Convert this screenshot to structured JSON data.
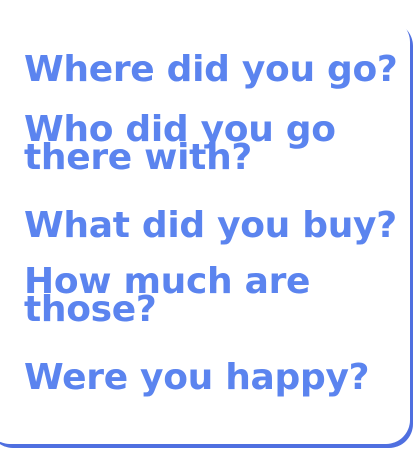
{
  "questions": [
    "Where did you go?",
    "Who did you go there with?",
    "What did you buy?",
    "How much are those?",
    "Were you happy?"
  ],
  "q2_lines": [
    "Who did you go",
    "there with?"
  ],
  "q4_lines": [
    "How much are",
    "those?"
  ],
  "colors": {
    "text": "#5b84ef",
    "card_shadow": "#4f6fe0",
    "background": "#ffffff"
  }
}
